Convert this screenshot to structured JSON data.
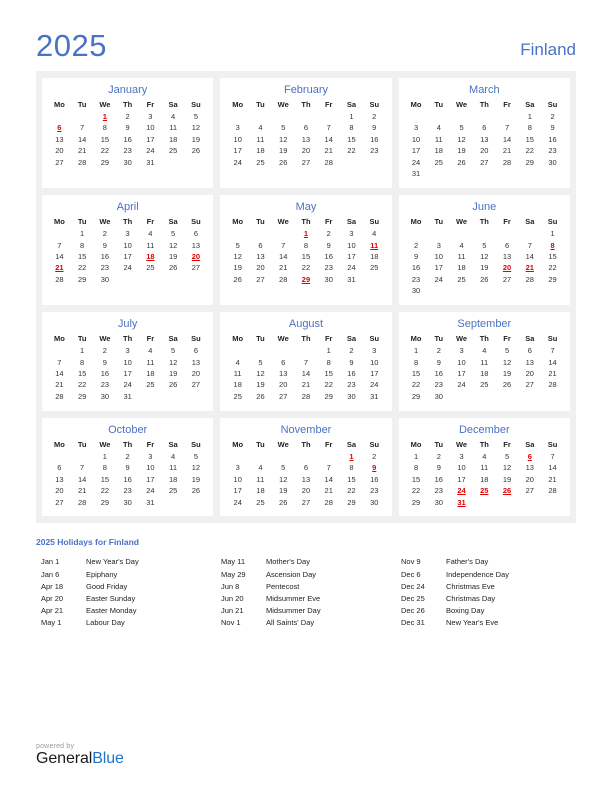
{
  "header": {
    "year": "2025",
    "country": "Finland",
    "accent_color": "#4a72c4",
    "holiday_color": "#e30000"
  },
  "weekday_headers": [
    "Mo",
    "Tu",
    "We",
    "Th",
    "Fr",
    "Sa",
    "Su"
  ],
  "months": [
    {
      "name": "January",
      "weeks": [
        [
          "",
          "",
          "1",
          "2",
          "3",
          "4",
          "5"
        ],
        [
          "6",
          "7",
          "8",
          "9",
          "10",
          "11",
          "12"
        ],
        [
          "13",
          "14",
          "15",
          "16",
          "17",
          "18",
          "19"
        ],
        [
          "20",
          "21",
          "22",
          "23",
          "24",
          "25",
          "26"
        ],
        [
          "27",
          "28",
          "29",
          "30",
          "31",
          "",
          ""
        ]
      ],
      "holidays": [
        "1",
        "6"
      ]
    },
    {
      "name": "February",
      "weeks": [
        [
          "",
          "",
          "",
          "",
          "",
          "1",
          "2"
        ],
        [
          "3",
          "4",
          "5",
          "6",
          "7",
          "8",
          "9"
        ],
        [
          "10",
          "11",
          "12",
          "13",
          "14",
          "15",
          "16"
        ],
        [
          "17",
          "18",
          "19",
          "20",
          "21",
          "22",
          "23"
        ],
        [
          "24",
          "25",
          "26",
          "27",
          "28",
          "",
          ""
        ]
      ],
      "holidays": []
    },
    {
      "name": "March",
      "weeks": [
        [
          "",
          "",
          "",
          "",
          "",
          "1",
          "2"
        ],
        [
          "3",
          "4",
          "5",
          "6",
          "7",
          "8",
          "9"
        ],
        [
          "10",
          "11",
          "12",
          "13",
          "14",
          "15",
          "16"
        ],
        [
          "17",
          "18",
          "19",
          "20",
          "21",
          "22",
          "23"
        ],
        [
          "24",
          "25",
          "26",
          "27",
          "28",
          "29",
          "30"
        ],
        [
          "31",
          "",
          "",
          "",
          "",
          "",
          ""
        ]
      ],
      "holidays": []
    },
    {
      "name": "April",
      "weeks": [
        [
          "",
          "1",
          "2",
          "3",
          "4",
          "5",
          "6"
        ],
        [
          "7",
          "8",
          "9",
          "10",
          "11",
          "12",
          "13"
        ],
        [
          "14",
          "15",
          "16",
          "17",
          "18",
          "19",
          "20"
        ],
        [
          "21",
          "22",
          "23",
          "24",
          "25",
          "26",
          "27"
        ],
        [
          "28",
          "29",
          "30",
          "",
          "",
          "",
          ""
        ]
      ],
      "holidays": [
        "18",
        "20",
        "21"
      ]
    },
    {
      "name": "May",
      "weeks": [
        [
          "",
          "",
          "",
          "1",
          "2",
          "3",
          "4"
        ],
        [
          "5",
          "6",
          "7",
          "8",
          "9",
          "10",
          "11"
        ],
        [
          "12",
          "13",
          "14",
          "15",
          "16",
          "17",
          "18"
        ],
        [
          "19",
          "20",
          "21",
          "22",
          "23",
          "24",
          "25"
        ],
        [
          "26",
          "27",
          "28",
          "29",
          "30",
          "31",
          ""
        ]
      ],
      "holidays": [
        "1",
        "11",
        "29"
      ]
    },
    {
      "name": "June",
      "weeks": [
        [
          "",
          "",
          "",
          "",
          "",
          "",
          "1"
        ],
        [
          "2",
          "3",
          "4",
          "5",
          "6",
          "7",
          "8"
        ],
        [
          "9",
          "10",
          "11",
          "12",
          "13",
          "14",
          "15"
        ],
        [
          "16",
          "17",
          "18",
          "19",
          "20",
          "21",
          "22"
        ],
        [
          "23",
          "24",
          "25",
          "26",
          "27",
          "28",
          "29"
        ],
        [
          "30",
          "",
          "",
          "",
          "",
          "",
          ""
        ]
      ],
      "holidays": [
        "8",
        "20",
        "21"
      ]
    },
    {
      "name": "July",
      "weeks": [
        [
          "",
          "1",
          "2",
          "3",
          "4",
          "5",
          "6"
        ],
        [
          "7",
          "8",
          "9",
          "10",
          "11",
          "12",
          "13"
        ],
        [
          "14",
          "15",
          "16",
          "17",
          "18",
          "19",
          "20"
        ],
        [
          "21",
          "22",
          "23",
          "24",
          "25",
          "26",
          "27"
        ],
        [
          "28",
          "29",
          "30",
          "31",
          "",
          "",
          ""
        ]
      ],
      "holidays": []
    },
    {
      "name": "August",
      "weeks": [
        [
          "",
          "",
          "",
          "",
          "1",
          "2",
          "3"
        ],
        [
          "4",
          "5",
          "6",
          "7",
          "8",
          "9",
          "10"
        ],
        [
          "11",
          "12",
          "13",
          "14",
          "15",
          "16",
          "17"
        ],
        [
          "18",
          "19",
          "20",
          "21",
          "22",
          "23",
          "24"
        ],
        [
          "25",
          "26",
          "27",
          "28",
          "29",
          "30",
          "31"
        ]
      ],
      "holidays": []
    },
    {
      "name": "September",
      "weeks": [
        [
          "1",
          "2",
          "3",
          "4",
          "5",
          "6",
          "7"
        ],
        [
          "8",
          "9",
          "10",
          "11",
          "12",
          "13",
          "14"
        ],
        [
          "15",
          "16",
          "17",
          "18",
          "19",
          "20",
          "21"
        ],
        [
          "22",
          "23",
          "24",
          "25",
          "26",
          "27",
          "28"
        ],
        [
          "29",
          "30",
          "",
          "",
          "",
          "",
          ""
        ]
      ],
      "holidays": []
    },
    {
      "name": "October",
      "weeks": [
        [
          "",
          "",
          "1",
          "2",
          "3",
          "4",
          "5"
        ],
        [
          "6",
          "7",
          "8",
          "9",
          "10",
          "11",
          "12"
        ],
        [
          "13",
          "14",
          "15",
          "16",
          "17",
          "18",
          "19"
        ],
        [
          "20",
          "21",
          "22",
          "23",
          "24",
          "25",
          "26"
        ],
        [
          "27",
          "28",
          "29",
          "30",
          "31",
          "",
          ""
        ]
      ],
      "holidays": []
    },
    {
      "name": "November",
      "weeks": [
        [
          "",
          "",
          "",
          "",
          "",
          "1",
          "2"
        ],
        [
          "3",
          "4",
          "5",
          "6",
          "7",
          "8",
          "9"
        ],
        [
          "10",
          "11",
          "12",
          "13",
          "14",
          "15",
          "16"
        ],
        [
          "17",
          "18",
          "19",
          "20",
          "21",
          "22",
          "23"
        ],
        [
          "24",
          "25",
          "26",
          "27",
          "28",
          "29",
          "30"
        ]
      ],
      "holidays": [
        "1",
        "9"
      ]
    },
    {
      "name": "December",
      "weeks": [
        [
          "1",
          "2",
          "3",
          "4",
          "5",
          "6",
          "7"
        ],
        [
          "8",
          "9",
          "10",
          "11",
          "12",
          "13",
          "14"
        ],
        [
          "15",
          "16",
          "17",
          "18",
          "19",
          "20",
          "21"
        ],
        [
          "22",
          "23",
          "24",
          "25",
          "26",
          "27",
          "28"
        ],
        [
          "29",
          "30",
          "31",
          "",
          "",
          "",
          ""
        ]
      ],
      "holidays": [
        "6",
        "24",
        "25",
        "26",
        "31"
      ]
    }
  ],
  "holidays_section": {
    "title": "2025 Holidays for Finland",
    "columns": [
      [
        {
          "date": "Jan 1",
          "name": "New Year's Day"
        },
        {
          "date": "Jan 6",
          "name": "Epiphany"
        },
        {
          "date": "Apr 18",
          "name": "Good Friday"
        },
        {
          "date": "Apr 20",
          "name": "Easter Sunday"
        },
        {
          "date": "Apr 21",
          "name": "Easter Monday"
        },
        {
          "date": "May 1",
          "name": "Labour Day"
        }
      ],
      [
        {
          "date": "May 11",
          "name": "Mother's Day"
        },
        {
          "date": "May 29",
          "name": "Ascension Day"
        },
        {
          "date": "Jun 8",
          "name": "Pentecost"
        },
        {
          "date": "Jun 20",
          "name": "Midsummer Eve"
        },
        {
          "date": "Jun 21",
          "name": "Midsummer Day"
        },
        {
          "date": "Nov 1",
          "name": "All Saints' Day"
        }
      ],
      [
        {
          "date": "Nov 9",
          "name": "Father's Day"
        },
        {
          "date": "Dec 6",
          "name": "Independence Day"
        },
        {
          "date": "Dec 24",
          "name": "Christmas Eve"
        },
        {
          "date": "Dec 25",
          "name": "Christmas Day"
        },
        {
          "date": "Dec 26",
          "name": "Boxing Day"
        },
        {
          "date": "Dec 31",
          "name": "New Year's Eve"
        }
      ]
    ]
  },
  "footer": {
    "powered_by": "powered by",
    "brand_first": "General",
    "brand_second": "Blue"
  }
}
